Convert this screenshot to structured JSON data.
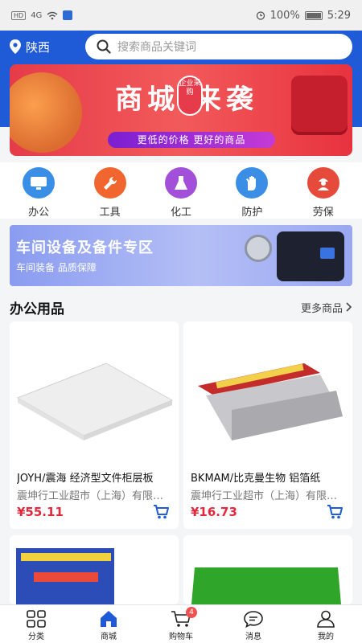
{
  "status_bar": {
    "net_tag": "HD",
    "signal": "4G",
    "battery_pct": "100%",
    "time": "5:29"
  },
  "header": {
    "location": "陕西",
    "search_placeholder": "搜索商品关键词",
    "brand_color": "#1f5bd6"
  },
  "banner": {
    "title": "商城 来袭",
    "badge": "企业采购",
    "subtitle": "更低的价格 更好的商品"
  },
  "categories": [
    {
      "label": "办公",
      "icon": "monitor-icon",
      "color": "#3a8ee6"
    },
    {
      "label": "工具",
      "icon": "wrench-icon",
      "color": "#f0662e"
    },
    {
      "label": "化工",
      "icon": "flask-icon",
      "color": "#a24fd9"
    },
    {
      "label": "防护",
      "icon": "glove-icon",
      "color": "#3a8ee6"
    },
    {
      "label": "劳保",
      "icon": "worker-icon",
      "color": "#e64a3b"
    }
  ],
  "workshop": {
    "title": "车间设备及备件专区",
    "subtitle": "车间装备 品质保障"
  },
  "section": {
    "title": "办公用品",
    "more": "更多商品"
  },
  "products": [
    {
      "name": "JOYH/震海 经济型文件柜层板",
      "shop": "震坤行工业超市（上海）有限公司",
      "price": "¥55.11",
      "image": "white-shelf-board"
    },
    {
      "name": "BKMAM/比克曼生物 铝箔纸",
      "shop": "震坤行工业超市（上海）有限公司",
      "price": "¥16.73",
      "image": "aluminium-foil-roll"
    },
    {
      "name": "",
      "shop": "",
      "price": "",
      "image": "boxed-product"
    },
    {
      "name": "",
      "shop": "",
      "price": "",
      "image": "green-cloth"
    }
  ],
  "tabbar": [
    {
      "label": "分类",
      "icon": "grid-icon",
      "active": false
    },
    {
      "label": "商城",
      "icon": "home-icon",
      "active": true
    },
    {
      "label": "购物车",
      "icon": "cart-icon",
      "active": false,
      "badge": "4"
    },
    {
      "label": "消息",
      "icon": "message-icon",
      "active": false
    },
    {
      "label": "我的",
      "icon": "user-icon",
      "active": false
    }
  ]
}
